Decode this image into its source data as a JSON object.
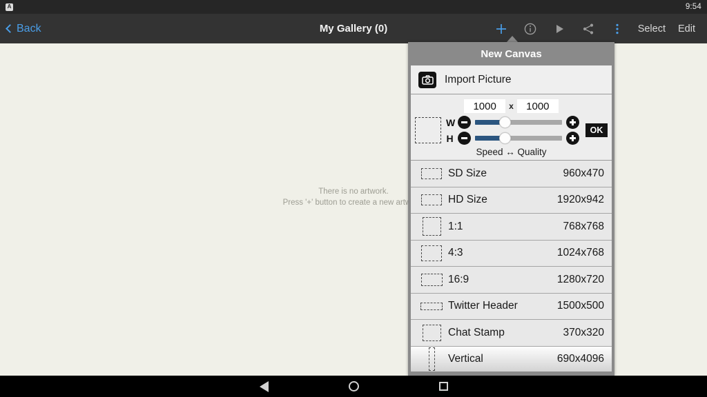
{
  "statusbar": {
    "app_icon": "app-badge-icon",
    "app_letter": "A",
    "clock": "9:54"
  },
  "actionbar": {
    "back_label": "Back",
    "title": "My Gallery (0)",
    "icons": [
      {
        "name": "plus-icon",
        "glyph": "+",
        "color": "#4a9ee8"
      },
      {
        "name": "info-icon",
        "glyph": "i",
        "color": "#9b9b9b"
      },
      {
        "name": "play-icon",
        "glyph": "play",
        "color": "#9b9b9b"
      },
      {
        "name": "share-icon",
        "glyph": "share",
        "color": "#9b9b9b"
      },
      {
        "name": "overflow-menu-icon",
        "glyph": "kebab",
        "color": "#4a9ee8"
      }
    ],
    "select_label": "Select",
    "edit_label": "Edit"
  },
  "gallery": {
    "empty_line1": "There is no artwork.",
    "empty_line2": "Press '+' button to create a new artwork."
  },
  "dialog": {
    "title": "New Canvas",
    "import": {
      "label": "Import Picture",
      "icon": "camera-icon"
    },
    "size": {
      "width_value": "1000",
      "height_value": "1000",
      "separator": "x",
      "w_label": "W",
      "h_label": "H",
      "minus_label": "−",
      "plus_label": "+",
      "ok_label": "OK",
      "quality_label": "Speed ↔ Quality",
      "w_slider_percent": 34,
      "h_slider_percent": 34
    },
    "presets": [
      {
        "name": "SD Size",
        "dimensions": "960x470",
        "tw": 30,
        "th": 16
      },
      {
        "name": "HD Size",
        "dimensions": "1920x942",
        "tw": 30,
        "th": 16
      },
      {
        "name": "1:1",
        "dimensions": "768x768",
        "tw": 27,
        "th": 27
      },
      {
        "name": "4:3",
        "dimensions": "1024x768",
        "tw": 30,
        "th": 23
      },
      {
        "name": "16:9",
        "dimensions": "1280x720",
        "tw": 31,
        "th": 18
      },
      {
        "name": "Twitter Header",
        "dimensions": "1500x500",
        "tw": 32,
        "th": 11
      },
      {
        "name": "Chat Stamp",
        "dimensions": "370x320",
        "tw": 27,
        "th": 24
      },
      {
        "name": "Vertical",
        "dimensions": "690x4096",
        "tw": 9,
        "th": 34
      }
    ]
  },
  "navbar": {
    "back": "nav-back-icon",
    "home": "nav-home-icon",
    "recents": "nav-recents-icon"
  },
  "colors": {
    "accent": "#4a9ee8",
    "slider_fill": "#2b557f",
    "canvas_bg": "#f0f0e8"
  }
}
